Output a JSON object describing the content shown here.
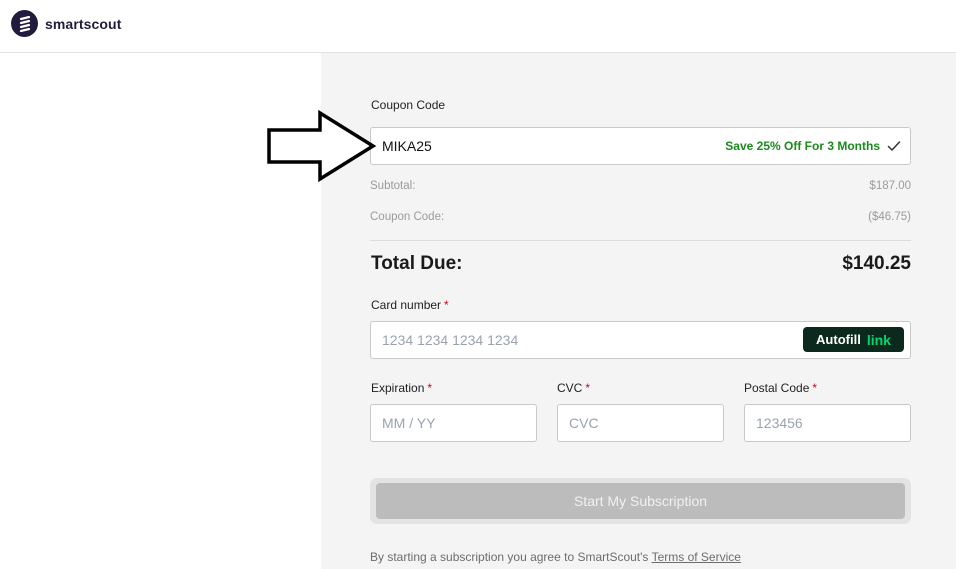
{
  "header": {
    "brand": "smartscout"
  },
  "coupon": {
    "label": "Coupon Code",
    "value": "MIKA25",
    "status_message": "Save 25% Off For 3 Months",
    "status_color": "#1c8a1c"
  },
  "summary": {
    "subtotal_label": "Subtotal:",
    "subtotal_value": "$187.00",
    "coupon_label": "Coupon Code:",
    "coupon_value": "($46.75)",
    "total_label": "Total Due:",
    "total_value": "$140.25"
  },
  "card": {
    "label": "Card number",
    "required_mark": "*",
    "placeholder": "1234 1234 1234 1234",
    "autofill_label": "Autofill",
    "autofill_link": "link"
  },
  "expiration": {
    "label": "Expiration",
    "placeholder": "MM / YY"
  },
  "cvc": {
    "label": "CVC",
    "placeholder": "CVC"
  },
  "postal": {
    "label": "Postal Code",
    "placeholder": "123456"
  },
  "submit": {
    "label": "Start My Subscription"
  },
  "terms": {
    "text": "By starting a subscription you agree to SmartScout's",
    "link": "Terms of Service"
  },
  "colors": {
    "brand": "#231b3d",
    "required": "#d0021b",
    "autofill_bg": "#0b2a1d",
    "autofill_accent": "#00d66f"
  }
}
